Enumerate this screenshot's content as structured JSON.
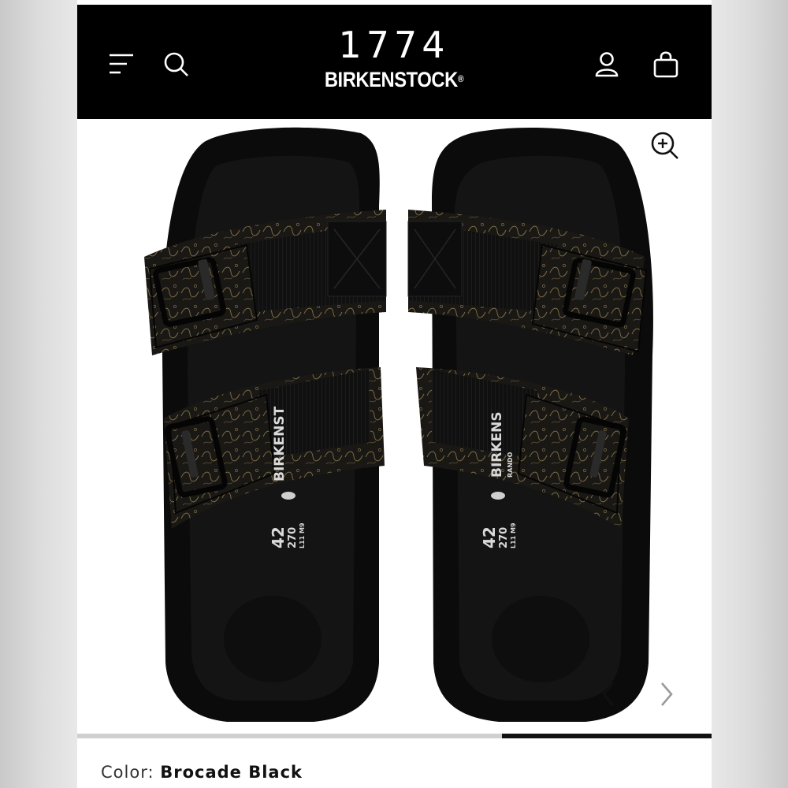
{
  "header": {
    "logo_year": "1774",
    "logo_brand": "BIRKENSTOCK",
    "logo_mark": "®",
    "icons": [
      "menu-icon",
      "search-icon",
      "account-icon",
      "shopping-bag-icon"
    ]
  },
  "gallery": {
    "zoom_icon": "zoom-in-icon",
    "prev_icon": "chevron-left-icon",
    "next_icon": "chevron-right-icon",
    "progress": 0.33,
    "footbed_left": {
      "size": "42",
      "mm": "270",
      "us": "L11 M9",
      "brand": "BIRKENST"
    },
    "footbed_right": {
      "size": "42",
      "mm": "270",
      "us": "L11 M9",
      "brand": "BIRKENS",
      "sub": "RANDO"
    },
    "colors": {
      "sole": "#0b0b0b",
      "strap": "#121212",
      "brocade": "#1a1814",
      "thread": "#7a6a48"
    }
  },
  "product": {
    "color_label": "Color:",
    "color_value": "Brocade Black"
  }
}
